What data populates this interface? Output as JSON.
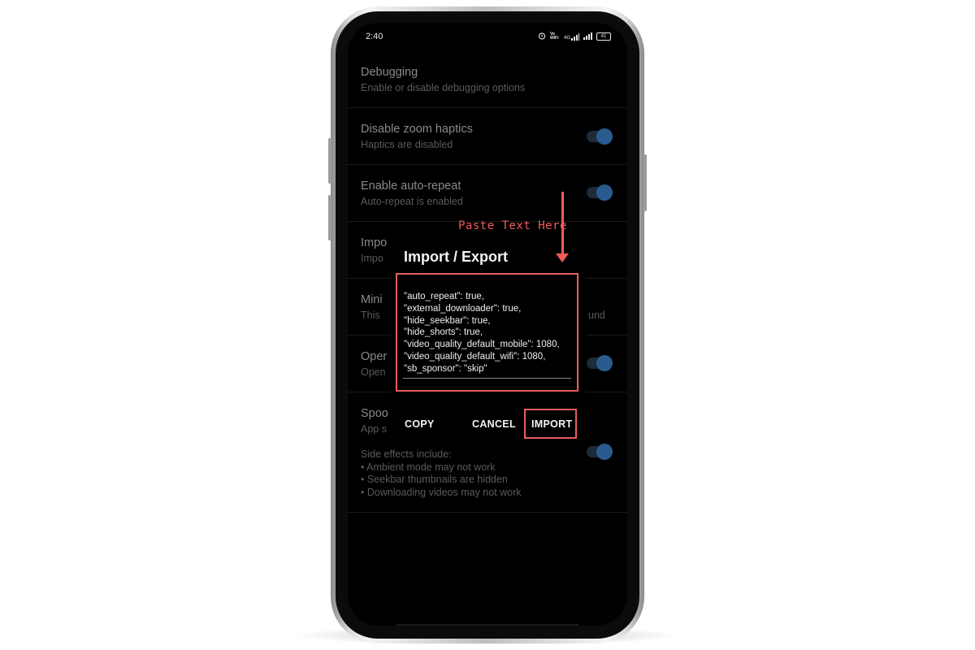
{
  "status_bar": {
    "time": "2:40",
    "network_label": "Vo WiFi",
    "lte_label": "4G",
    "battery": "41",
    "icons": [
      "alarm-icon",
      "wifi-calling-icon",
      "signal-icon",
      "signal-icon",
      "battery-icon"
    ]
  },
  "settings": {
    "debugging": {
      "title": "Debugging",
      "subtitle": "Enable or disable debugging options"
    },
    "zoom_haptics": {
      "title": "Disable zoom haptics",
      "subtitle": "Haptics are disabled",
      "toggle_on": true
    },
    "auto_repeat": {
      "title": "Enable auto-repeat",
      "subtitle": "Auto-repeat is enabled",
      "toggle_on": true
    },
    "import_export": {
      "title": "Impo",
      "subtitle": "Impo"
    },
    "minimized": {
      "title": "Mini",
      "subtitle": "This",
      "subtitle_tail": "und"
    },
    "open_links": {
      "title": "Oper",
      "subtitle": "Open",
      "toggle_on": true
    },
    "spoof": {
      "title": "Spoo",
      "subtitle": "App s",
      "toggle_on": true,
      "side_effects": "Side effects include:\n• Ambient mode may not work\n• Seekbar thumbnails are hidden\n• Downloading videos may not work"
    }
  },
  "dialog": {
    "title": "Import / Export",
    "json_text": "\"auto_repeat\": true,\n\"external_downloader\": true,\n\"hide_seekbar\": true,\n\"hide_shorts\": true,\n\"video_quality_default_mobile\": 1080,\n\"video_quality_default_wifi\": 1080,\n\"sb_sponsor\": \"skip\"",
    "copy_label": "COPY",
    "cancel_label": "CANCEL",
    "import_label": "IMPORT"
  },
  "annotation": {
    "text": "Paste Text Here",
    "color": "#ef5b5b"
  },
  "colors": {
    "toggle_knob": "#2a5a8e",
    "highlight": "#e85d5d"
  }
}
